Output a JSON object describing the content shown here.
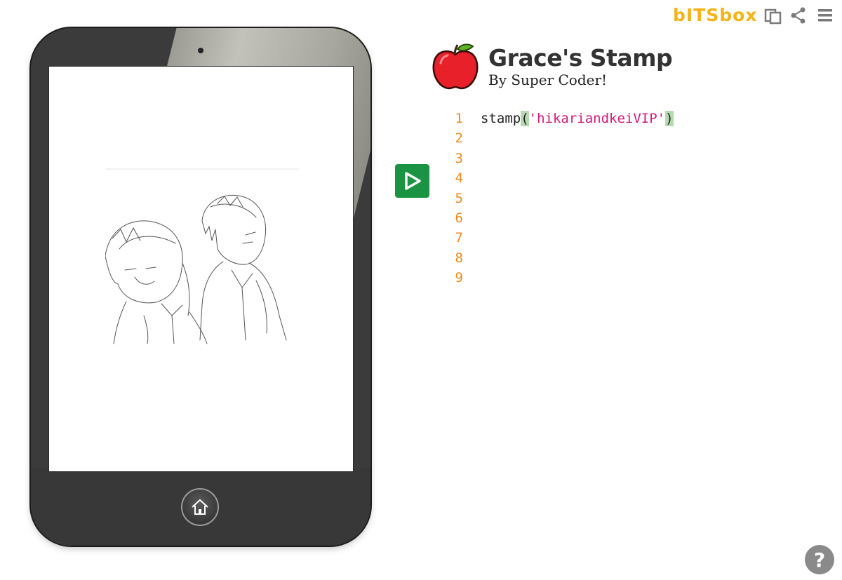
{
  "header": {
    "logo_text": "bITSbox",
    "icons": [
      "copy-icon",
      "share-icon",
      "menu-icon"
    ]
  },
  "app": {
    "title": "Grace's Stamp",
    "author": "By Super Coder!",
    "icon": "apple-icon"
  },
  "editor": {
    "line_numbers": [
      "1",
      "2",
      "3",
      "4",
      "5",
      "6",
      "7",
      "8",
      "9"
    ],
    "code": {
      "func": "stamp",
      "open_paren": "(",
      "string": "'hikariandkeiVIP'",
      "close_paren": ")"
    }
  },
  "controls": {
    "run_icon": "play-icon",
    "home_icon": "home-icon",
    "help_label": "?"
  },
  "colors": {
    "accent_logo": "#f5b318",
    "run_button": "#1a9443",
    "line_numbers": "#f0891c",
    "string": "#d4197b"
  }
}
